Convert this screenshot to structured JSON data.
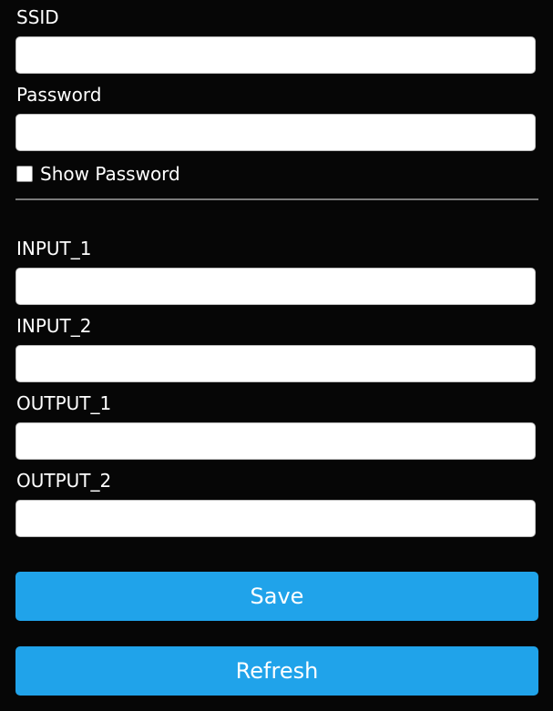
{
  "wifi": {
    "ssid_label": "SSID",
    "ssid_value": "",
    "password_label": "Password",
    "password_value": "",
    "show_password_label": "Show Password",
    "show_password_checked": false
  },
  "io": {
    "input_1_label": "INPUT_1",
    "input_1_value": "",
    "input_2_label": "INPUT_2",
    "input_2_value": "",
    "output_1_label": "OUTPUT_1",
    "output_1_value": "",
    "output_2_label": "OUTPUT_2",
    "output_2_value": ""
  },
  "actions": {
    "save_label": "Save",
    "refresh_label": "Refresh"
  },
  "colors": {
    "background": "#060606",
    "button": "#20a3ea",
    "text": "#ffffff"
  }
}
